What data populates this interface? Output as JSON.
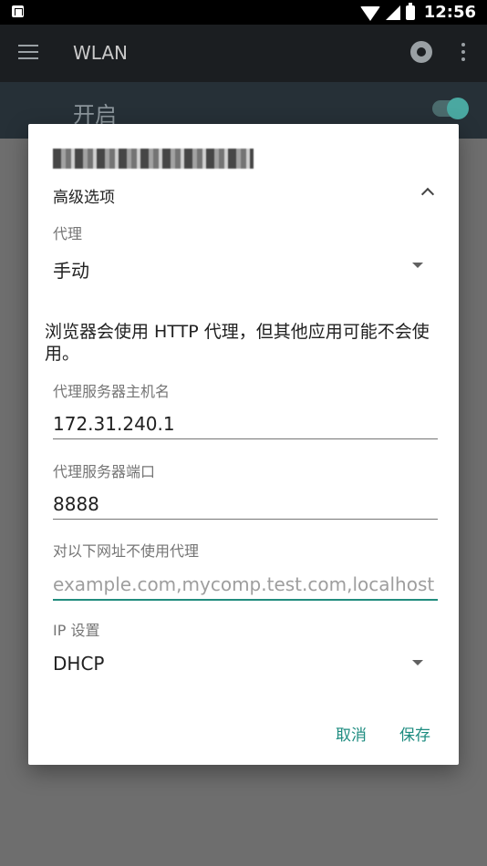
{
  "status_bar": {
    "time": "12:56"
  },
  "app_bar": {
    "title": "WLAN"
  },
  "switch_row": {
    "label": "开启"
  },
  "dialog": {
    "advanced_label": "高级选项",
    "proxy": {
      "label": "代理",
      "value": "手动"
    },
    "note": "浏览器会使用 HTTP 代理，但其他应用可能不会使用。",
    "host": {
      "label": "代理服务器主机名",
      "value": "172.31.240.1"
    },
    "port": {
      "label": "代理服务器端口",
      "value": "8888"
    },
    "bypass": {
      "label": "对以下网址不使用代理",
      "placeholder": "example.com,mycomp.test.com,localhost"
    },
    "ip_settings": {
      "label": "IP 设置",
      "value": "DHCP"
    },
    "actions": {
      "cancel": "取消",
      "save": "保存"
    }
  },
  "colors": {
    "accent": "#1e8c80",
    "app_bar": "#1b1e21"
  }
}
